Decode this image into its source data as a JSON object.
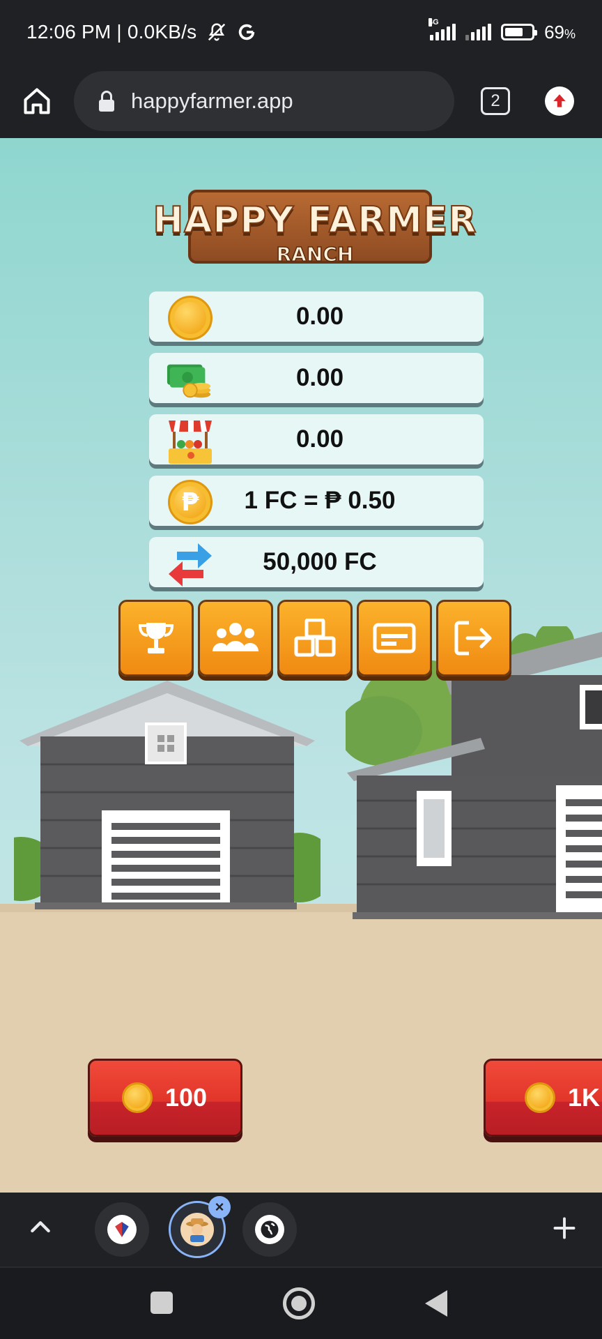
{
  "status_bar": {
    "time_speed": "12:06 PM | 0.0KB/s",
    "network_label": "4G",
    "battery": "69",
    "battery_unit": "%",
    "battery_level": 0.69,
    "icons": [
      "bell-off-icon",
      "google-icon",
      "signal-icon",
      "battery-icon"
    ]
  },
  "browser": {
    "url": "happyfarmer.app",
    "tab_count": "2"
  },
  "game": {
    "logo_title": "HAPPY FARMER",
    "logo_subtitle": "RANCH",
    "stats": [
      {
        "icon": "gold-coin-icon",
        "value": "0.00"
      },
      {
        "icon": "cash-coins-icon",
        "value": "0.00"
      },
      {
        "icon": "market-stall-icon",
        "value": "0.00"
      },
      {
        "icon": "peso-coin-icon",
        "value": "1 FC = ₱ 0.50"
      },
      {
        "icon": "exchange-arrows-icon",
        "value": "50,000 FC"
      }
    ],
    "menu": [
      "trophy-icon",
      "users-icon",
      "boxes-icon",
      "card-icon",
      "logout-icon"
    ],
    "buy_buttons": [
      {
        "label": "100"
      },
      {
        "label": "1K"
      }
    ]
  },
  "colors": {
    "sky": "#a7dcd9",
    "ground": "#e2cfb0",
    "menu_orange": "#f5a01c",
    "buy_red": "#e2352a",
    "browser_dark": "#202124"
  }
}
